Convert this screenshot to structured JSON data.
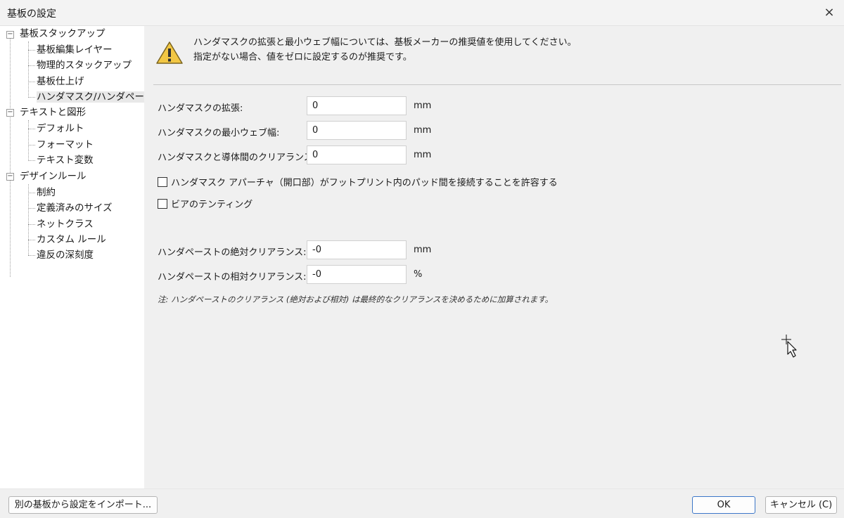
{
  "window": {
    "title": "基板の設定",
    "close_icon": "×"
  },
  "tree": {
    "groups": [
      {
        "label": "基板スタックアップ",
        "children": [
          "基板編集レイヤー",
          "物理的スタックアップ",
          "基板仕上げ",
          "ハンダマスク/ハンダペースト"
        ]
      },
      {
        "label": "テキストと図形",
        "children": [
          "デフォルト",
          "フォーマット",
          "テキスト変数"
        ]
      },
      {
        "label": "デザインルール",
        "children": [
          "制約",
          "定義済みのサイズ",
          "ネットクラス",
          "カスタム ルール",
          "違反の深刻度"
        ]
      }
    ],
    "expander_glyph": "−",
    "selected": "ハンダマスク/ハンダペースト"
  },
  "warning": {
    "line1": "ハンダマスクの拡張と最小ウェブ幅については、基板メーカーの推奨値を使用してください。",
    "line2": "指定がない場合、値をゼロに設定するのが推奨です。",
    "icon": "warning-triangle",
    "color": "#f2c744"
  },
  "fields": {
    "mask_expansion": {
      "label": "ハンダマスクの拡張:",
      "value": "0",
      "unit": "mm"
    },
    "mask_min_web": {
      "label": "ハンダマスクの最小ウェブ幅:",
      "value": "0",
      "unit": "mm"
    },
    "mask_to_copper": {
      "label": "ハンダマスクと導体間のクリアランス:",
      "value": "0",
      "unit": "mm"
    },
    "paste_abs": {
      "label": "ハンダペーストの絶対クリアランス:",
      "value": "-0",
      "unit": "mm"
    },
    "paste_rel": {
      "label": "ハンダペーストの相対クリアランス:",
      "value": "-0",
      "unit": "%"
    }
  },
  "checkboxes": {
    "allow_bridged": {
      "label": "ハンダマスク アパーチャ（開口部）がフットプリント内のパッド間を接続することを許容する",
      "checked": false
    },
    "tent_vias": {
      "label": "ビアのテンティング",
      "checked": false
    }
  },
  "note": "注: ハンダペーストのクリアランス (絶対および相対) は最終的なクリアランスを決めるために加算されます。",
  "footer": {
    "import_label": "別の基板から設定をインポート...",
    "ok_label": "OK",
    "cancel_label": "キャンセル (C)"
  },
  "colors": {
    "primary_button_border": "#3c77c8",
    "selected_item_bg": "#e8e8e8"
  }
}
